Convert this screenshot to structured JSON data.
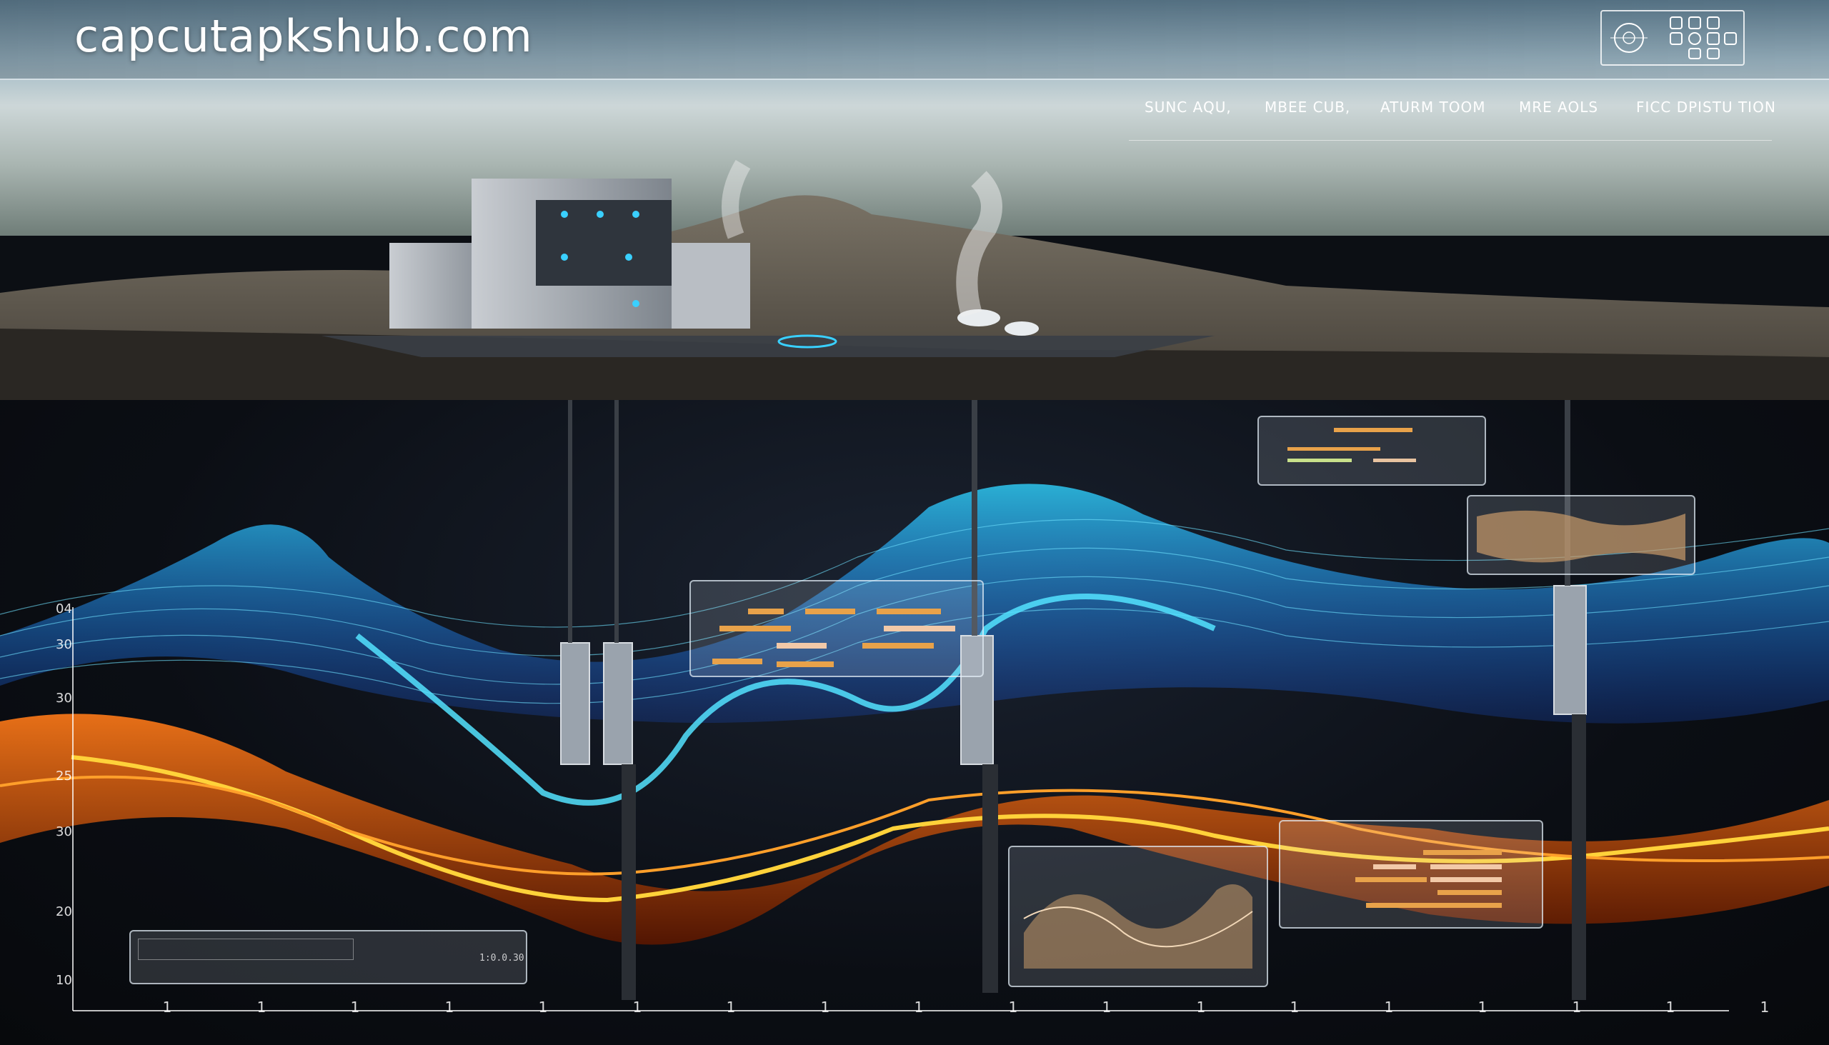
{
  "header": {
    "brand": "capcutapkshub.com"
  },
  "nav": {
    "items": [
      {
        "label": "SUNC AQU,"
      },
      {
        "label": "MBEE CUB,"
      },
      {
        "label": "ATURM TOOM"
      },
      {
        "label": "MRE AOLS"
      },
      {
        "label": "FICC DPISTU TION"
      }
    ]
  },
  "axis": {
    "y_labels": [
      "04",
      "30",
      "30",
      "25",
      "30",
      "20",
      "10"
    ],
    "x_labels": [
      "1",
      "1",
      "1",
      "1",
      "1",
      "1",
      "1",
      "1",
      "1",
      "1",
      "1",
      "1",
      "1",
      "1",
      "1",
      "1",
      "1",
      "1"
    ]
  },
  "panels": {
    "bottom_left_text": "1:0.0.30"
  },
  "colors": {
    "accent_cyan": "#2fd4ff",
    "accent_orange": "#ff8a1f",
    "accent_yellow": "#ffd23a",
    "panel_bar_orange": "#e8a24a",
    "panel_bar_peach": "#f2c9a8"
  },
  "icons": {
    "logo": "emblem-grid-icon"
  }
}
